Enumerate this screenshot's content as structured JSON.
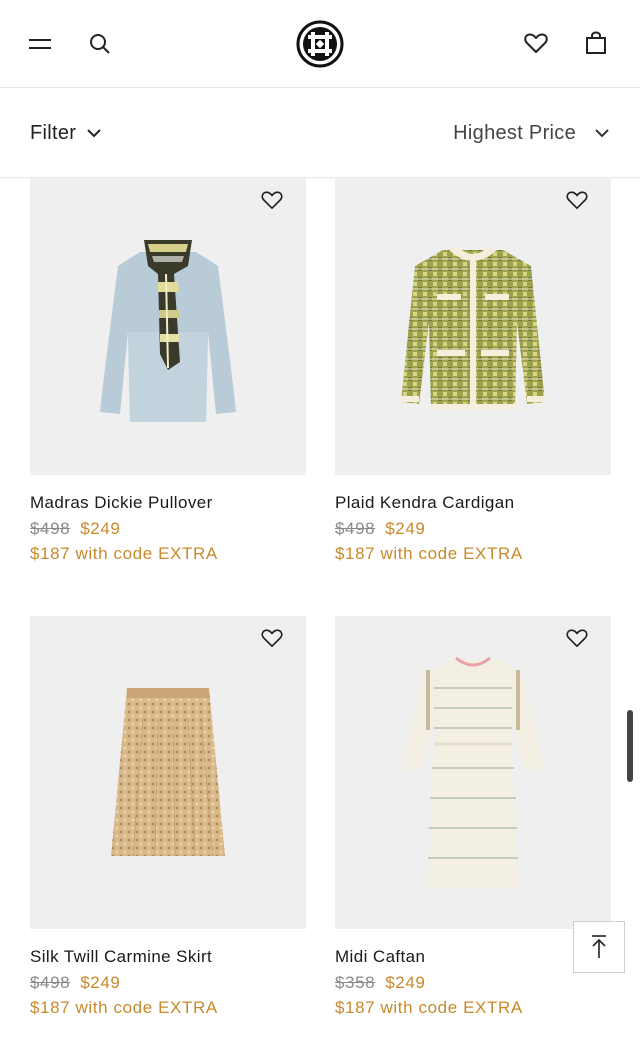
{
  "header": {
    "menu_icon": "hamburger-menu-icon",
    "search_icon": "search-icon",
    "logo": "tory-burch-logo",
    "wishlist_icon": "heart-icon",
    "bag_icon": "shopping-bag-icon"
  },
  "filter_bar": {
    "filter_label": "Filter",
    "sort_label": "Highest Price"
  },
  "colors": {
    "sale": "#c9892a",
    "image_bg": "#efefef",
    "strike": "#8a8a8a"
  },
  "products": [
    {
      "name": "Madras Dickie Pullover",
      "original_price": "$498",
      "sale_price": "$249",
      "promo": "$187 with code EXTRA",
      "image": "sweater-with-plaid-scarf"
    },
    {
      "name": "Plaid Kendra Cardigan",
      "original_price": "$498",
      "sale_price": "$249",
      "promo": "$187 with code EXTRA",
      "image": "plaid-cardigan-jacket"
    },
    {
      "name": "Silk Twill Carmine Skirt",
      "original_price": "$498",
      "sale_price": "$249",
      "promo": "$187 with code EXTRA",
      "image": "pleated-printed-skirt"
    },
    {
      "name": "Midi Caftan",
      "original_price": "$358",
      "sale_price": "$249",
      "promo": "$187 with code EXTRA",
      "image": "white-striped-midi-dress"
    }
  ],
  "back_to_top_icon": "arrow-up-to-top-icon"
}
